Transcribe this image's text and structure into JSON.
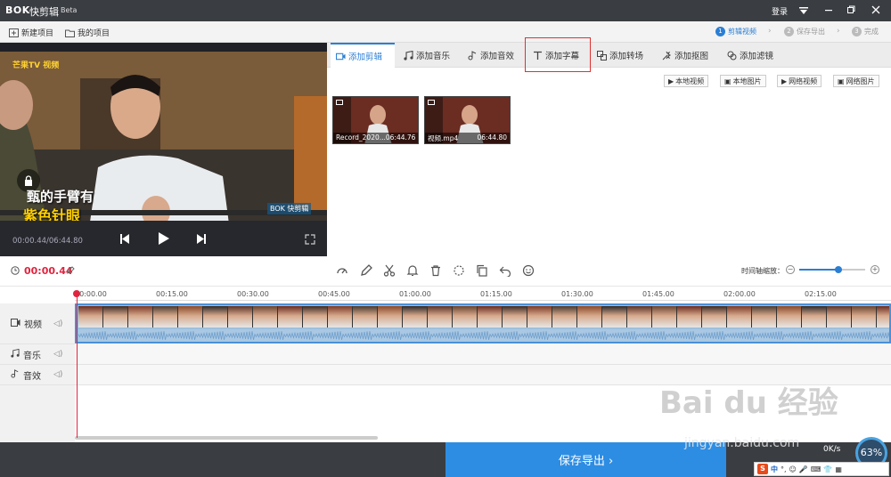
{
  "titlebar": {
    "logo": "BOK",
    "app_name": "快剪辑",
    "beta": "Beta",
    "login": "登录",
    "menu_icon": "menu-icon",
    "min_icon": "minimize-icon",
    "max_icon": "maximize-icon",
    "close_icon": "close-icon"
  },
  "toolbar": {
    "new_project": "新建项目",
    "my_projects": "我的项目"
  },
  "steps": [
    {
      "num": "1",
      "label": "剪辑视频"
    },
    {
      "num": "2",
      "label": "保存导出"
    },
    {
      "num": "3",
      "label": "完成"
    }
  ],
  "preview": {
    "channel_logo": "芒果TV 视频",
    "subtitle_line1": "甄的手臂有",
    "subtitle_line2": "紫色针眼",
    "corner_logo": "BOK 快剪辑",
    "timecode": "00:00.44/06:44.80"
  },
  "tabs": [
    {
      "label": "添加剪辑",
      "icon": "video-camera-icon"
    },
    {
      "label": "添加音乐",
      "icon": "music-note-icon"
    },
    {
      "label": "添加音效",
      "icon": "sound-effect-icon"
    },
    {
      "label": "添加字幕",
      "icon": "text-icon"
    },
    {
      "label": "添加转场",
      "icon": "transition-icon"
    },
    {
      "label": "添加抠图",
      "icon": "cutout-icon"
    },
    {
      "label": "添加滤镜",
      "icon": "filter-icon"
    }
  ],
  "sources": [
    "本地视频",
    "本地图片",
    "网络视频",
    "网络图片"
  ],
  "clips": [
    {
      "name": "Record_2020...",
      "duration": "06:44.76"
    },
    {
      "name": "视频.mp4",
      "duration": "06:44.80"
    }
  ],
  "controls": {
    "current_time": "00:00.44",
    "zoom_label": "时间轴缩放："
  },
  "ruler": [
    "00:00.00",
    "00:15.00",
    "00:30.00",
    "00:45.00",
    "01:00.00",
    "01:15.00",
    "01:30.00",
    "01:45.00",
    "02:00.00",
    "02:15.00"
  ],
  "tracks": {
    "video": "视频",
    "music": "音乐",
    "sfx": "音效"
  },
  "export": {
    "label": "保存导出 ›"
  },
  "overlay": {
    "watermark": "Bai du 经验",
    "url": "jingyan.baidu.com",
    "speed_percent": "63%",
    "speed_rate": "0K/s"
  },
  "ime": {
    "logo": "S",
    "lang": "中"
  },
  "colors": {
    "accent": "#2a7fd5",
    "time_red": "#e0243f",
    "highlight_box": "#e03030",
    "export_bg": "#2d8de3"
  }
}
